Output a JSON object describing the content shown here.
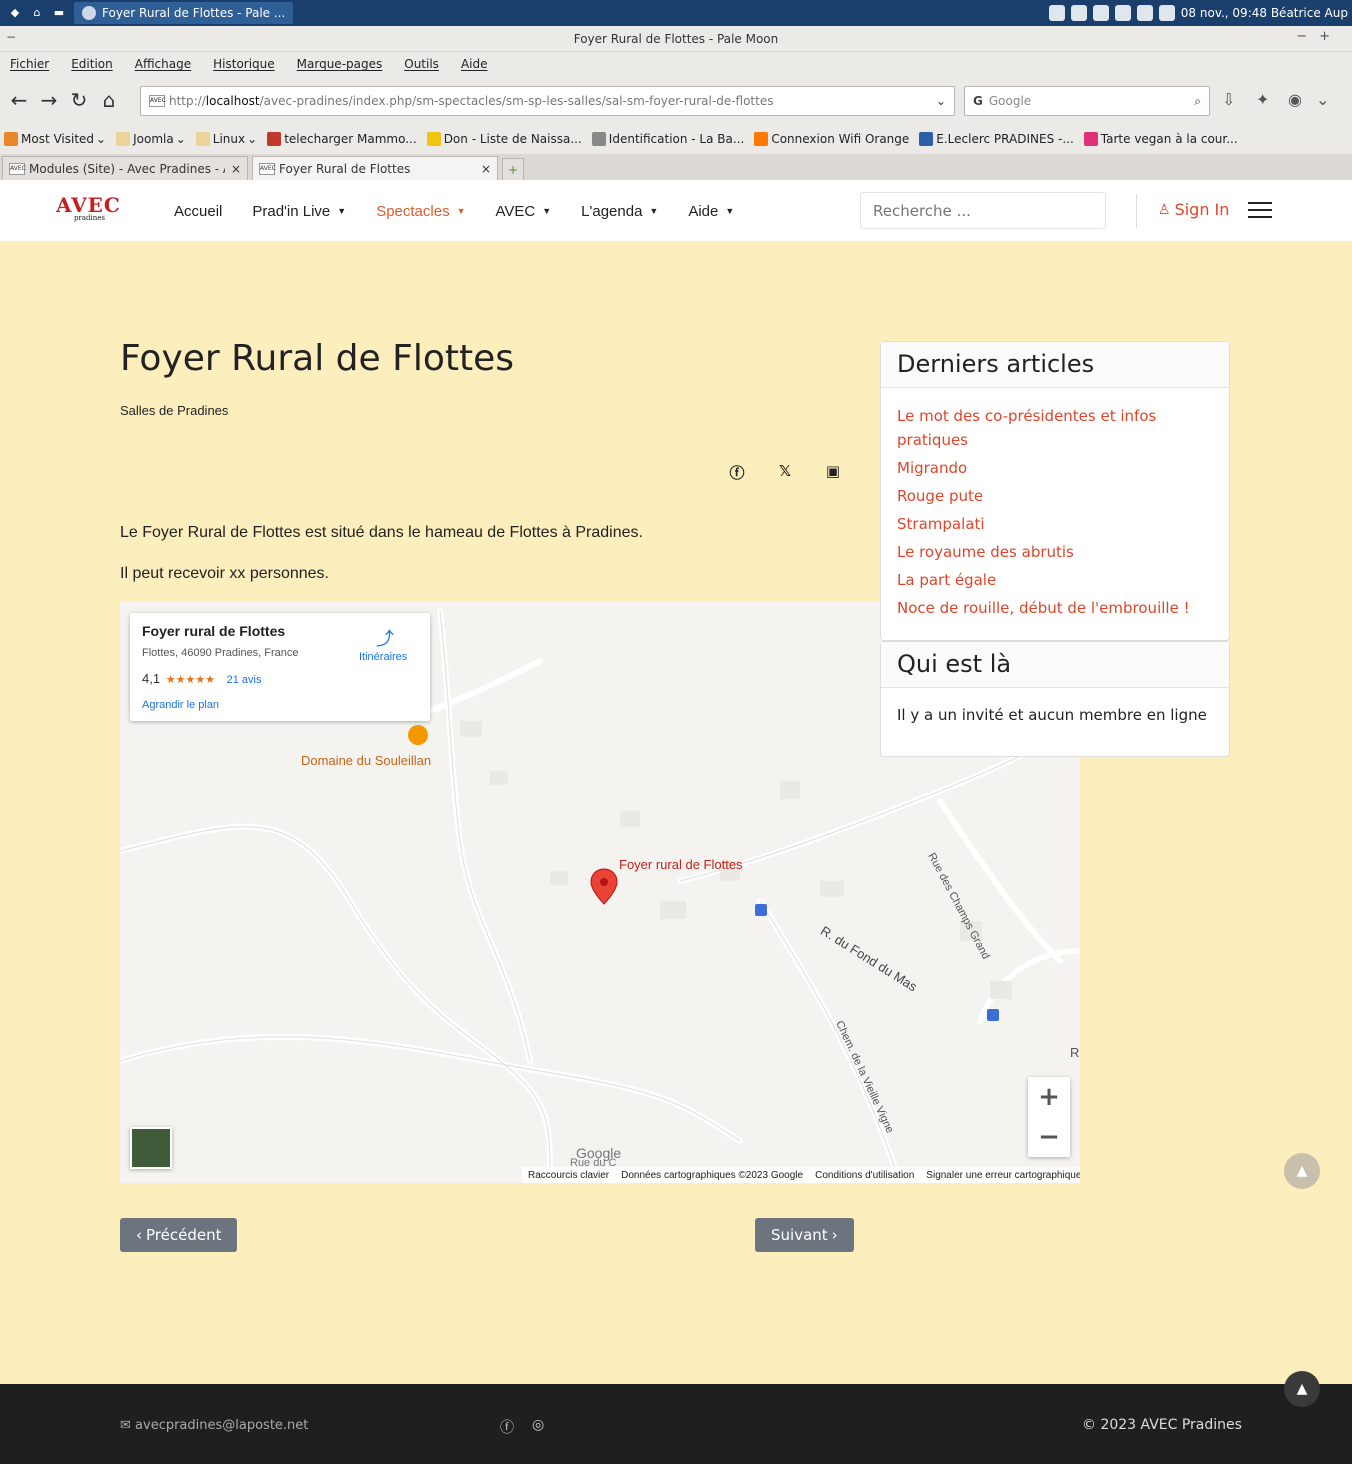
{
  "taskbar": {
    "window_task": "Foyer Rural de Flottes - Pale ...",
    "clock": "08 nov., 09:48 Béatrice Aup"
  },
  "browser": {
    "title": "Foyer Rural de Flottes - Pale Moon",
    "menu": [
      "Fichier",
      "Edition",
      "Affichage",
      "Historique",
      "Marque-pages",
      "Outils",
      "Aide"
    ],
    "url_prefix": "http://",
    "url_host": "localhost",
    "url_path": "/avec-pradines/index.php/sm-spectacles/sm-sp-les-salles/sal-sm-foyer-rural-de-flottes",
    "search_engine_letter": "G",
    "search_placeholder": "Google",
    "bookmarks": [
      {
        "label": "Most Visited",
        "color": "#e8862a",
        "dropdown": true
      },
      {
        "label": "Joomla",
        "color": "#e9d59a",
        "dropdown": true
      },
      {
        "label": "Linux",
        "color": "#e9d59a",
        "dropdown": true
      },
      {
        "label": "telecharger Mammo...",
        "color": "#c0392b",
        "dropdown": false
      },
      {
        "label": "Don - Liste de Naissa...",
        "color": "#f1c40f",
        "dropdown": false
      },
      {
        "label": "Identification - La Ba...",
        "color": "#888888",
        "dropdown": false
      },
      {
        "label": "Connexion Wifi Orange",
        "color": "#ff7900",
        "dropdown": false
      },
      {
        "label": "E.Leclerc PRADINES -...",
        "color": "#2d5fa8",
        "dropdown": false
      },
      {
        "label": "Tarte vegan à la cour...",
        "color": "#e0307a",
        "dropdown": false
      }
    ],
    "tabs": [
      {
        "label": "Modules (Site) - Avec Pradines - Ad",
        "active": false
      },
      {
        "label": "Foyer Rural de Flottes",
        "active": true
      }
    ],
    "tab_close": "×",
    "favicon_text": "AVEC"
  },
  "site": {
    "logo_text": "AVEC",
    "logo_sub": "pradines",
    "nav": [
      {
        "label": "Accueil",
        "dropdown": false,
        "active": false
      },
      {
        "label": "Prad'in Live",
        "dropdown": true,
        "active": false
      },
      {
        "label": "Spectacles",
        "dropdown": true,
        "active": true
      },
      {
        "label": "AVEC",
        "dropdown": true,
        "active": false
      },
      {
        "label": "L'agenda",
        "dropdown": true,
        "active": false
      },
      {
        "label": "Aide",
        "dropdown": true,
        "active": false
      }
    ],
    "search_placeholder": "Recherche ...",
    "signin": "Sign In",
    "accent": "#e0452a"
  },
  "article": {
    "title": "Foyer Rural de Flottes",
    "category": "Salles de Pradines",
    "paragraphs": [
      "Le Foyer Rural de Flottes est situé dans le hameau de Flottes à Pradines.",
      "Il peut recevoir xx personnes."
    ],
    "prev": "Précédent",
    "next": "Suivant"
  },
  "map": {
    "place_name": "Foyer rural de Flottes",
    "address": "Flottes, 46090 Pradines, France",
    "rating": "4,1",
    "stars": "★★★★★",
    "reviews": "21 avis",
    "enlarge": "Agrandir le plan",
    "directions": "Itinéraires",
    "poi": "Domaine du Souleillan",
    "marker_label": "Foyer rural de Flottes",
    "roads": [
      "Rue des Champs Grand",
      "R. du Fond du Mas",
      "Chem. de la Vieille Vigne",
      "R",
      "Rue du C"
    ],
    "logo": "Google",
    "footer": [
      "Raccourcis clavier",
      "Données cartographiques ©2023 Google",
      "Conditions d'utilisation",
      "Signaler une erreur cartographique"
    ],
    "zoom_in": "+",
    "zoom_out": "−"
  },
  "sidebar": {
    "latest_title": "Derniers articles",
    "latest": [
      "Le mot des co-présidentes et infos pratiques",
      "Migrando",
      "Rouge pute",
      "Strampalati",
      "Le royaume des abrutis",
      "La part égale",
      "Noce de rouille, début de l'embrouille !"
    ],
    "online_title": "Qui est là",
    "online_text": "Il y a un invité et aucun membre en ligne"
  },
  "footer": {
    "email": "avecpradines@laposte.net",
    "copyright": "© 2023 AVEC Pradines"
  }
}
